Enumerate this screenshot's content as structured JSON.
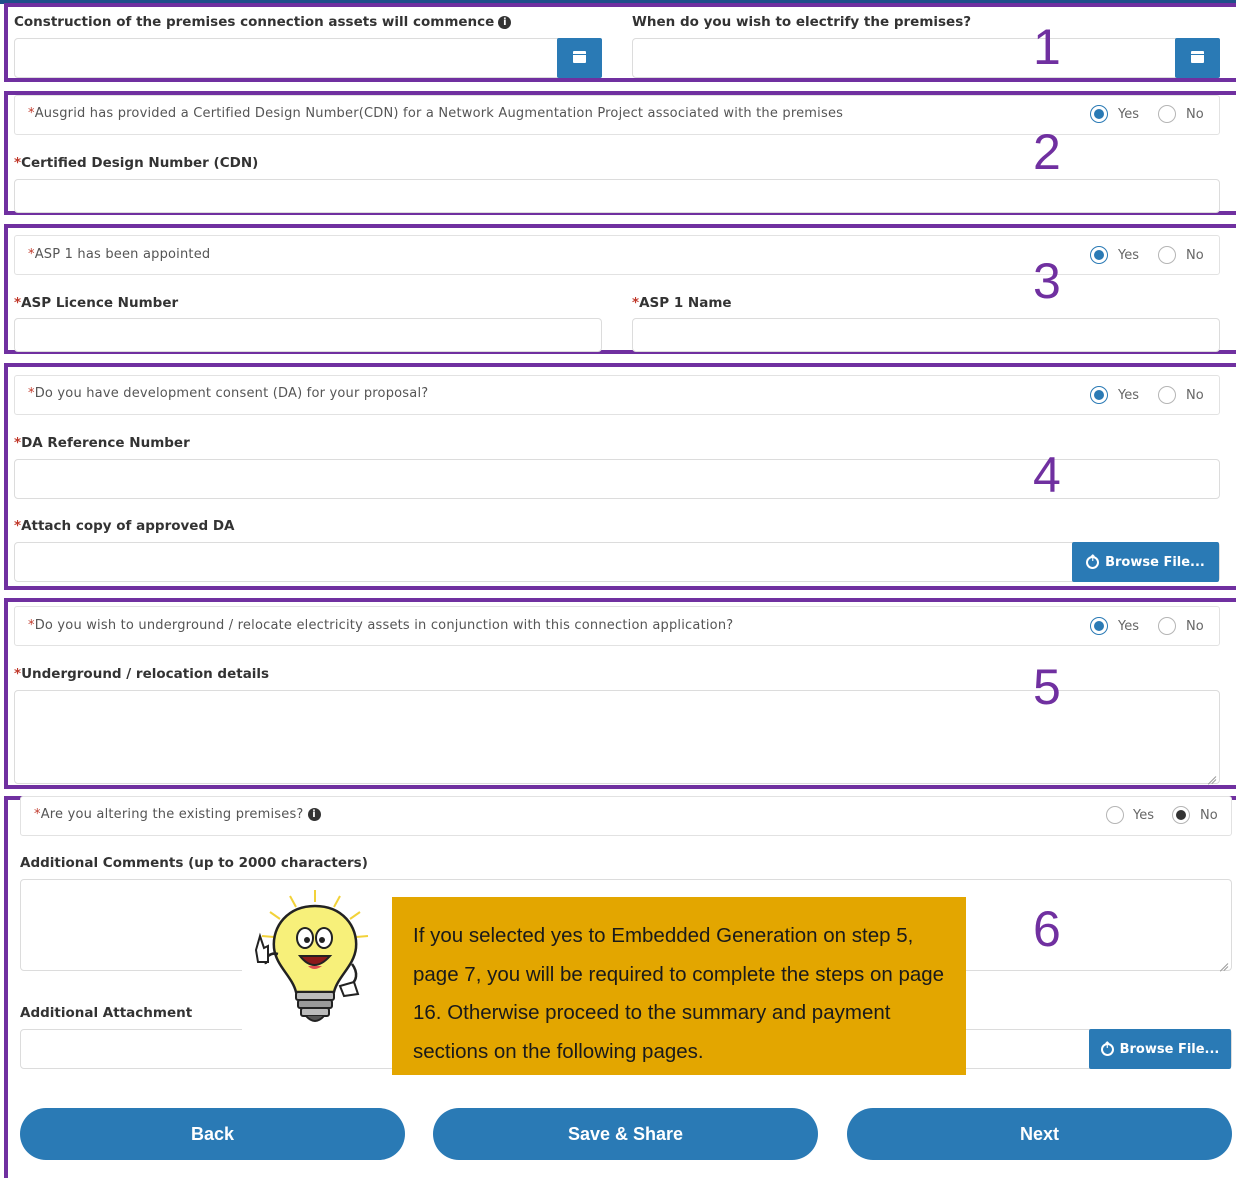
{
  "section_numbers": [
    "1",
    "2",
    "3",
    "4",
    "5",
    "6"
  ],
  "s1": {
    "construction_label": "Construction of the premises connection assets will commence",
    "electrify_label": "When do you wish to electrify the premises?"
  },
  "s2": {
    "question": "Ausgrid has provided a Certified Design Number(CDN) for a Network Augmentation Project associated with the premises",
    "cdn_label": "Certified Design Number (CDN)"
  },
  "s3": {
    "question": "ASP 1 has been appointed",
    "licence_label": "ASP Licence Number",
    "name_label": "ASP 1 Name"
  },
  "s4": {
    "question": "Do you have development consent (DA) for your proposal?",
    "da_ref_label": "DA Reference Number",
    "attach_label": "Attach copy of approved DA"
  },
  "s5": {
    "question": "Do you wish to underground / relocate electricity assets in conjunction with this connection application?",
    "details_label": "Underground / relocation details"
  },
  "s6": {
    "question": "Are you altering the existing premises?",
    "comments_label": "Additional Comments (up to 2000 characters)",
    "attachment_label": "Additional Attachment"
  },
  "common": {
    "required_mark": "*",
    "yes": "Yes",
    "no": "No",
    "browse": "Browse File..."
  },
  "nav": {
    "back": "Back",
    "save_share": "Save & Share",
    "next": "Next"
  },
  "callout": {
    "text": "If you selected yes to Embedded Generation on step 5, page 7, you will be required to complete the steps on page 16. Otherwise proceed to the summary and payment sections on the following pages."
  },
  "colors": {
    "accent": "#2a7ab5",
    "section_border": "#7030a0",
    "callout_bg": "#e3a600",
    "required": "#c0392b"
  },
  "icons": [
    "calendar-icon",
    "info-icon",
    "upload-icon",
    "lightbulb-mascot"
  ]
}
